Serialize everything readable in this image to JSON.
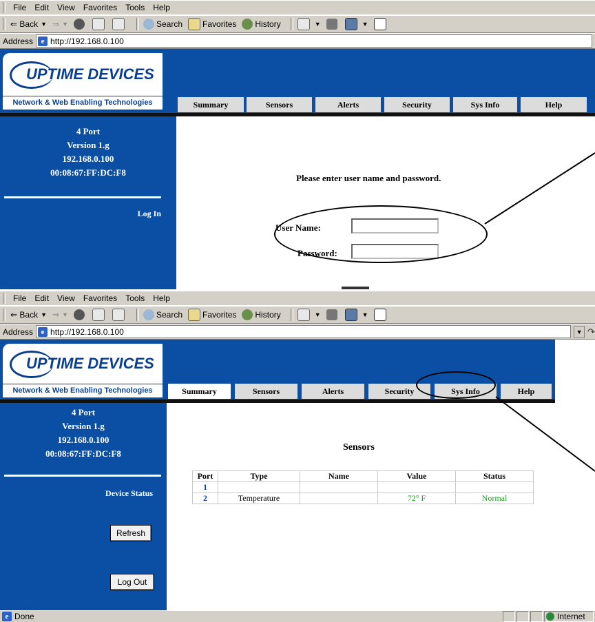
{
  "browser": {
    "menu": [
      "File",
      "Edit",
      "View",
      "Favorites",
      "Tools",
      "Help"
    ],
    "toolbar": {
      "back": "Back",
      "search": "Search",
      "favorites": "Favorites",
      "history": "History"
    },
    "address_label": "Address",
    "url": "http://192.168.0.100"
  },
  "logo": {
    "brand": "UPTIME DEVICES",
    "tagline": "Network & Web Enabling Technologies"
  },
  "nav_tabs": [
    "Summary",
    "Sensors",
    "Alerts",
    "Security",
    "Sys Info",
    "Help"
  ],
  "device": {
    "line1": "4 Port",
    "line2": "Version 1.g",
    "ip": "192.168.0.100",
    "mac": "00:08:67:FF:DC:F8"
  },
  "login_page": {
    "side_link": "Log In",
    "message": "Please enter user name and password.",
    "username_label": "User Name:",
    "password_label": "Password:"
  },
  "status_page": {
    "side_title": "Device Status",
    "refresh_button": "Refresh",
    "logout_button": "Log Out",
    "sensors_title": "Sensors",
    "columns": [
      "Port",
      "Type",
      "Name",
      "Value",
      "Status"
    ],
    "rows": [
      {
        "port": "1",
        "type": "",
        "name": "",
        "value": "",
        "status": ""
      },
      {
        "port": "2",
        "type": "Temperature",
        "name": "",
        "value": "72° F",
        "status": "Normal"
      }
    ]
  },
  "statusbar": {
    "left": "Done",
    "zone": "Internet"
  },
  "colors": {
    "header_blue": "#0a4fa3",
    "tab_gray": "#dcdcdc",
    "status_green": "#1aa61a",
    "port_blue": "#0a3cb4"
  }
}
